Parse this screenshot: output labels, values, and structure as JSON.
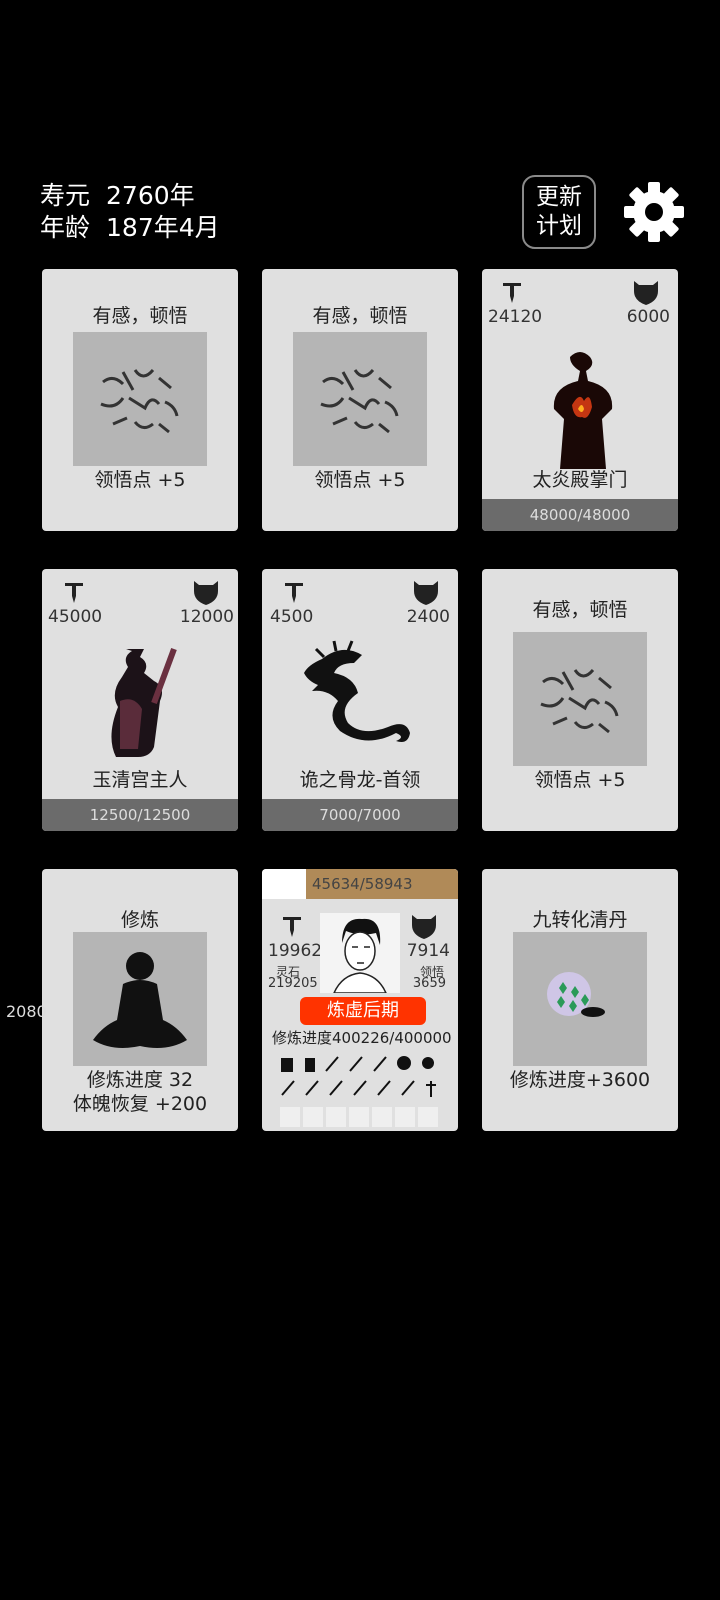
{
  "status": {
    "lifespan_label": "寿元",
    "lifespan_value": "2760年",
    "age_label": "年龄",
    "age_value": "187年4月"
  },
  "header": {
    "update_plan_line1": "更新",
    "update_plan_line2": "计划",
    "settings_icon": "gear-icon"
  },
  "cards": {
    "c1": {
      "title": "有感，顿悟",
      "reward": "领悟点  +5"
    },
    "c2": {
      "title": "有感，顿悟",
      "reward": "领悟点  +5"
    },
    "c3": {
      "attack": "24120",
      "defense": "6000",
      "name": "太炎殿掌门",
      "hp": "48000/48000"
    },
    "c4": {
      "attack": "45000",
      "defense": "12000",
      "name": "玉清宫主人",
      "hp": "12500/12500"
    },
    "c5": {
      "attack": "4500",
      "defense": "2400",
      "name": "诡之骨龙-首领",
      "hp": "7000/7000"
    },
    "c6": {
      "title": "有感，顿悟",
      "reward": "领悟点  +5"
    },
    "c7": {
      "title": "修炼",
      "progress": "修炼进度  32",
      "recover": "体魄恢复  +200"
    },
    "c8": {
      "hp": "45634/58943",
      "hp_fraction": 0.774,
      "attack": "19962",
      "spirit_stone_label": "灵石",
      "spirit_stone": "219205",
      "defense": "7914",
      "insight_label": "领悟",
      "insight": "3659",
      "realm": "炼虚后期",
      "cultivation_label": "修炼进度",
      "cultivation": "400226/400000"
    },
    "c9": {
      "title": "九转化清丹",
      "effect": "修炼进度+3600"
    }
  },
  "side_number": "2080",
  "colors": {
    "realm_badge": "#ff3300",
    "hp_fill": "#b08a58",
    "card": "#e0e0e0"
  }
}
